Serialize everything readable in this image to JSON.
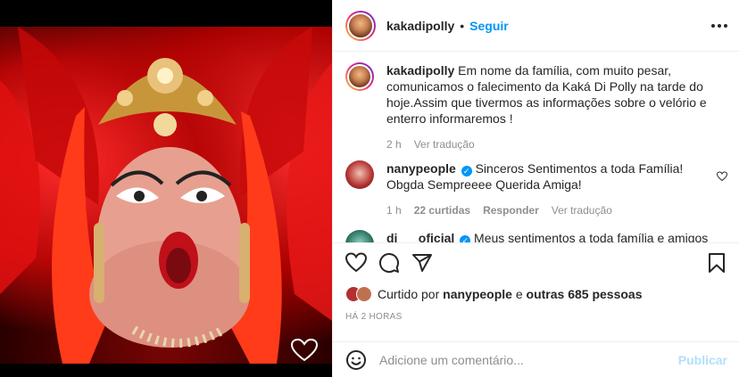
{
  "header": {
    "username": "kakadipolly",
    "separator": "•",
    "follow_label": "Seguir",
    "more_icon": "more-horizontal-icon"
  },
  "caption": {
    "username": "kakadipolly",
    "text": "Em nome da família, com muito pesar, comunicamos o falecimento da Kaká Di Polly na tarde do hoje.Assim que tivermos as informações sobre o velório e enterro informaremos !",
    "time": "2 h",
    "translate": "Ver tradução"
  },
  "comments": [
    {
      "username": "nanypeople",
      "verified": true,
      "text": "Sinceros Sentimentos a toda Família! Obgda Sempreeee Querida Amiga!",
      "time": "1 h",
      "likes": "22 curtidas",
      "reply": "Responder",
      "translate": "Ver tradução"
    },
    {
      "username": "dj___oficial",
      "verified": true,
      "text": "Meus sentimentos a toda família e amigos"
    }
  ],
  "actions": {
    "like_icon": "heart-icon",
    "comment_icon": "comment-icon",
    "share_icon": "share-icon",
    "save_icon": "bookmark-icon"
  },
  "likes": {
    "prefix": "Curtido por",
    "user": "nanypeople",
    "connector": "e",
    "others": "outras 685 pessoas"
  },
  "timestamp": "HÁ 2 HORAS",
  "composer": {
    "placeholder": "Adicione um comentário...",
    "publish_label": "Publicar"
  },
  "colors": {
    "accent": "#0095f6",
    "publish_disabled": "#b2dffc",
    "muted": "#8e8e8e"
  }
}
